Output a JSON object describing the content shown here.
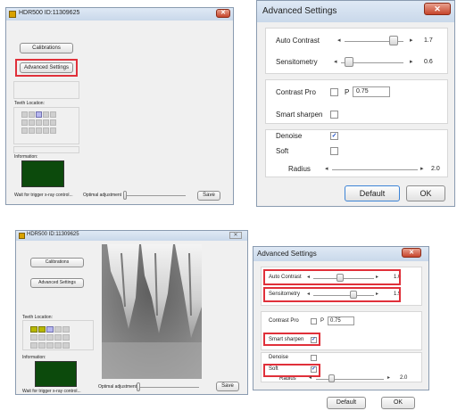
{
  "top_main": {
    "title": "HDR500   ID:11309625",
    "calibrations": "Calibrations",
    "advanced_settings": "Advanced Settings",
    "teeth_location": "Teeth Location:",
    "information": "Information:",
    "status": "Wait for trigger x-ray control...",
    "optimal_adjustment": "Optimal adjustment",
    "save": "Save"
  },
  "top_adv": {
    "title": "Advanced Settings",
    "auto_contrast": "Auto Contrast",
    "auto_contrast_value": "1.7",
    "sensitometry": "Sensitometry",
    "sensitometry_value": "0.6",
    "contrast_pro": "Contrast Pro",
    "p_label": "P",
    "p_value": "0.75",
    "smart_sharpen": "Smart sharpen",
    "denoise": "Denoise",
    "soft": "Soft",
    "radius": "Radius",
    "radius_value": "2.0",
    "default": "Default",
    "ok": "OK",
    "denoise_checked": true
  },
  "bot_main": {
    "title": "HDR500   ID:11309625",
    "calibrations": "Calibrations",
    "advanced_settings": "Advanced Settings",
    "teeth_location": "Teeth Location:",
    "information": "Information:",
    "status": "Wait for trigger x-ray control...",
    "optimal_adjustment": "Optimal adjustment",
    "save": "Save"
  },
  "bot_adv": {
    "title": "Advanced Settings",
    "auto_contrast": "Auto Contrast",
    "auto_contrast_value": "1.0",
    "sensitometry": "Sensitometry",
    "sensitometry_value": "1.9",
    "contrast_pro": "Contrast Pro",
    "p_label": "P",
    "p_value": "0.75",
    "smart_sharpen": "Smart sharpen",
    "denoise": "Denoise",
    "soft": "Soft",
    "radius": "Radius",
    "radius_value": "2.0",
    "default": "Default",
    "ok": "OK",
    "smart_sharpen_checked": true,
    "soft_checked": true
  },
  "icons": {
    "close": "close-icon",
    "arrow_left": "arrow-left-icon",
    "arrow_right": "arrow-right-icon",
    "check": "check-icon"
  },
  "colors": {
    "highlight": "#e0303a",
    "info_green": "#0c4a0c",
    "tooth_selected": "#b8b800",
    "tooth_selected_blue": "#b6b6ee"
  }
}
